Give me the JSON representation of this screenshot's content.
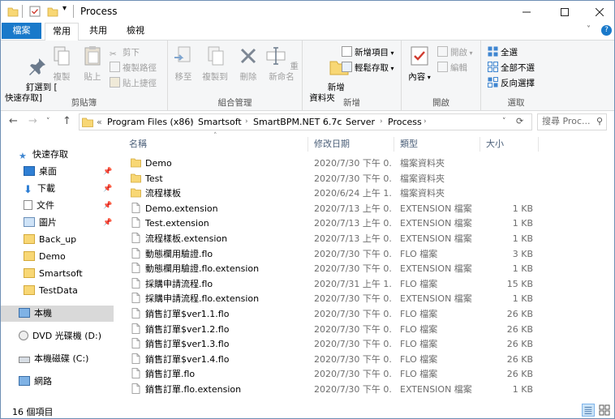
{
  "title": "Process",
  "ribbon_tabs": {
    "file": "檔案",
    "home": "常用",
    "share": "共用",
    "view": "檢視"
  },
  "ribbon": {
    "pin_label": "釘選到 [\n快速存取]",
    "copy": "複製",
    "paste": "貼上",
    "cut": "剪下",
    "copy_path": "複製路徑",
    "paste_shortcut": "貼上捷徑",
    "clipboard": "剪貼簿",
    "move_to": "移至",
    "copy_to": "複製到",
    "delete": "刪除",
    "rename": "重新命名",
    "organize": "組合管理",
    "new_folder": "新增\n資料夾",
    "new_item": "新增項目",
    "easy_access": "輕鬆存取",
    "new_group": "新增",
    "properties": "內容",
    "open": "開啟",
    "edit": "編輯",
    "open_group": "開啟",
    "select_all": "全選",
    "select_none": "全部不選",
    "invert_selection": "反向選擇",
    "select_group": "選取"
  },
  "address": {
    "prefix": "«",
    "crumbs": [
      "Program Files (x86)",
      "Smartsoft",
      "SmartBPM.NET 6.7c",
      "Server",
      "Process"
    ],
    "search_placeholder": "搜尋 Proc..."
  },
  "nav": {
    "quick_access": "快速存取",
    "desktop": "桌面",
    "downloads": "下載",
    "documents": "文件",
    "pictures": "圖片",
    "back_up": "Back_up",
    "demo": "Demo",
    "smartsoft": "Smartsoft",
    "testdata": "TestData",
    "this_pc": "本機",
    "dvd": "DVD 光碟機 (D:)",
    "local_disk": "本機磁碟 (C:)",
    "network": "網路"
  },
  "columns": {
    "name": "名稱",
    "date": "修改日期",
    "type": "類型",
    "size": "大小"
  },
  "files": [
    {
      "name": "Demo",
      "date": "2020/7/30 下午 0...",
      "type": "檔案資料夾",
      "size": "",
      "kind": "folder"
    },
    {
      "name": "Test",
      "date": "2020/7/30 下午 0...",
      "type": "檔案資料夾",
      "size": "",
      "kind": "folder"
    },
    {
      "name": "流程樣板",
      "date": "2020/6/24 上午 1...",
      "type": "檔案資料夾",
      "size": "",
      "kind": "folder"
    },
    {
      "name": "Demo.extension",
      "date": "2020/7/13 上午 0...",
      "type": "EXTENSION 檔案",
      "size": "1 KB",
      "kind": "file"
    },
    {
      "name": "Test.extension",
      "date": "2020/7/13 上午 0...",
      "type": "EXTENSION 檔案",
      "size": "1 KB",
      "kind": "file"
    },
    {
      "name": "流程樣板.extension",
      "date": "2020/7/13 上午 0...",
      "type": "EXTENSION 檔案",
      "size": "1 KB",
      "kind": "file"
    },
    {
      "name": "動態欄用驗證.flo",
      "date": "2020/7/30 下午 0...",
      "type": "FLO 檔案",
      "size": "3 KB",
      "kind": "file"
    },
    {
      "name": "動態欄用驗證.flo.extension",
      "date": "2020/7/30 下午 0...",
      "type": "EXTENSION 檔案",
      "size": "1 KB",
      "kind": "file"
    },
    {
      "name": "採購申請流程.flo",
      "date": "2020/7/31 上午 1...",
      "type": "FLO 檔案",
      "size": "15 KB",
      "kind": "file"
    },
    {
      "name": "採購申請流程.flo.extension",
      "date": "2020/7/30 下午 0...",
      "type": "EXTENSION 檔案",
      "size": "1 KB",
      "kind": "file"
    },
    {
      "name": "銷售訂單$ver1.1.flo",
      "date": "2020/7/30 下午 0...",
      "type": "FLO 檔案",
      "size": "26 KB",
      "kind": "file"
    },
    {
      "name": "銷售訂單$ver1.2.flo",
      "date": "2020/7/30 下午 0...",
      "type": "FLO 檔案",
      "size": "26 KB",
      "kind": "file"
    },
    {
      "name": "銷售訂單$ver1.3.flo",
      "date": "2020/7/30 下午 0...",
      "type": "FLO 檔案",
      "size": "26 KB",
      "kind": "file"
    },
    {
      "name": "銷售訂單$ver1.4.flo",
      "date": "2020/7/30 下午 0...",
      "type": "FLO 檔案",
      "size": "26 KB",
      "kind": "file"
    },
    {
      "name": "銷售訂單.flo",
      "date": "2020/7/30 下午 0...",
      "type": "FLO 檔案",
      "size": "26 KB",
      "kind": "file"
    },
    {
      "name": "銷售訂單.flo.extension",
      "date": "2020/7/30 下午 0...",
      "type": "EXTENSION 檔案",
      "size": "1 KB",
      "kind": "file"
    }
  ],
  "status": {
    "count": "16 個項目"
  },
  "colors": {
    "accent": "#1979ca",
    "folder": "#f8d775",
    "selected": "#d9d9d9"
  }
}
